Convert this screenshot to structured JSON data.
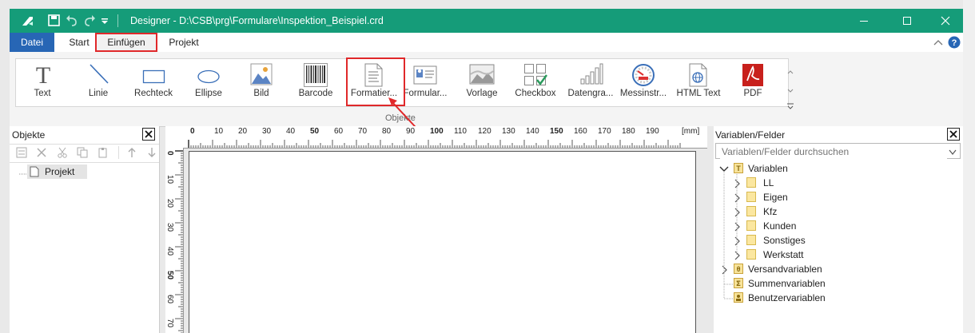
{
  "titlebar": {
    "title": "Designer - D:\\CSB\\prg\\Formulare\\Inspektion_Beispiel.crd",
    "icons": [
      "app-icon",
      "save-icon",
      "undo-icon",
      "redo-icon",
      "quick-access-dropdown-icon"
    ],
    "accent": "#159c79"
  },
  "menu": {
    "datei": "Datei",
    "start": "Start",
    "einfuegen": "Einfügen",
    "projekt": "Projekt",
    "accent": "#2766b5",
    "highlight": "#e0282a"
  },
  "ribbon": {
    "group_label": "Objekte",
    "tools": [
      {
        "label": "Text",
        "icon": "text-icon"
      },
      {
        "label": "Linie",
        "icon": "line-icon"
      },
      {
        "label": "Rechteck",
        "icon": "rectangle-icon"
      },
      {
        "label": "Ellipse",
        "icon": "ellipse-icon"
      },
      {
        "label": "Bild",
        "icon": "image-icon"
      },
      {
        "label": "Barcode",
        "icon": "barcode-icon"
      },
      {
        "label": "Formatier...",
        "icon": "formatted-text-icon"
      },
      {
        "label": "Formular...",
        "icon": "form-element-icon"
      },
      {
        "label": "Vorlage",
        "icon": "template-icon"
      },
      {
        "label": "Checkbox",
        "icon": "checkbox-icon"
      },
      {
        "label": "Datengra...",
        "icon": "data-graphic-icon"
      },
      {
        "label": "Messinstr...",
        "icon": "gauge-icon"
      },
      {
        "label": "HTML Text",
        "icon": "html-text-icon"
      },
      {
        "label": "PDF",
        "icon": "pdf-icon"
      }
    ]
  },
  "objects_panel": {
    "title": "Objekte",
    "root": "Projekt"
  },
  "ruler": {
    "h_labels": [
      "0",
      "10",
      "20",
      "30",
      "40",
      "50",
      "60",
      "70",
      "80",
      "90",
      "100",
      "110",
      "120",
      "130",
      "140",
      "150",
      "160",
      "170",
      "180",
      "190"
    ],
    "unit": "[mm]",
    "v_labels": [
      "0",
      "10",
      "20",
      "30",
      "40",
      "50",
      "60",
      "70"
    ]
  },
  "variables_panel": {
    "title": "Variablen/Felder",
    "search_placeholder": "Variablen/Felder durchsuchen",
    "root": "Variablen",
    "children": [
      "LL",
      "Eigen",
      "Kfz",
      "Kunden",
      "Sonstiges",
      "Werkstatt"
    ],
    "others": [
      "Versandvariablen",
      "Summenvariablen",
      "Benutzervariablen"
    ]
  }
}
